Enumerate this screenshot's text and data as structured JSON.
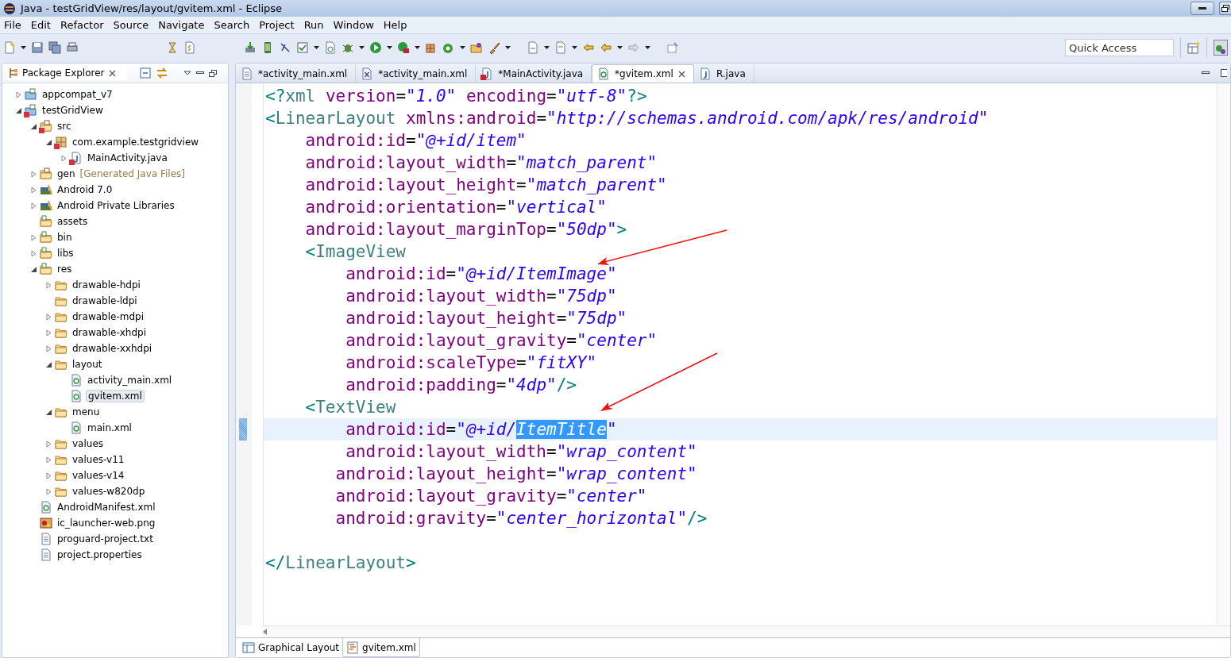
{
  "window": {
    "title": "Java - testGridView/res/layout/gvitem.xml - Eclipse"
  },
  "menu_items": [
    "File",
    "Edit",
    "Refactor",
    "Source",
    "Navigate",
    "Search",
    "Project",
    "Run",
    "Window",
    "Help"
  ],
  "quick_access": {
    "placeholder": "Quick Access"
  },
  "explorer": {
    "title": "Package Explorer",
    "items": [
      {
        "label": "appcompat_v7",
        "kind": "project",
        "selected": false,
        "expanded": false
      },
      {
        "label": "testGridView",
        "kind": "project",
        "selected": false,
        "error": true,
        "expanded": true,
        "children": [
          {
            "label": "src",
            "kind": "srcfolder",
            "selected": false,
            "error": true,
            "expanded": true,
            "children": [
              {
                "label": "com.example.testgridview",
                "kind": "package",
                "selected": false,
                "error": true,
                "expanded": true,
                "children": [
                  {
                    "label": "MainActivity.java",
                    "kind": "java",
                    "selected": false,
                    "error": true,
                    "expanded": false
                  }
                ]
              }
            ]
          },
          {
            "label": "gen",
            "decoration": "[Generated Java Files]",
            "kind": "srcfolder",
            "selected": false,
            "expanded": false
          },
          {
            "label": "Android 7.0",
            "kind": "library",
            "selected": false,
            "expanded": false
          },
          {
            "label": "Android Private Libraries",
            "kind": "library",
            "selected": false,
            "expanded": false
          },
          {
            "label": "assets",
            "kind": "folder",
            "selected": false
          },
          {
            "label": "bin",
            "kind": "folder",
            "selected": false,
            "expanded": false
          },
          {
            "label": "libs",
            "kind": "folder",
            "selected": false,
            "expanded": false
          },
          {
            "label": "res",
            "kind": "folder",
            "selected": false,
            "expanded": true,
            "children": [
              {
                "label": "drawable-hdpi",
                "kind": "plainfolder",
                "selected": false,
                "expanded": false
              },
              {
                "label": "drawable-ldpi",
                "kind": "plainfolder",
                "selected": false
              },
              {
                "label": "drawable-mdpi",
                "kind": "plainfolder",
                "selected": false,
                "expanded": false
              },
              {
                "label": "drawable-xhdpi",
                "kind": "plainfolder",
                "selected": false,
                "expanded": false
              },
              {
                "label": "drawable-xxhdpi",
                "kind": "plainfolder",
                "selected": false,
                "expanded": false
              },
              {
                "label": "layout",
                "kind": "plainfolder",
                "selected": false,
                "expanded": true,
                "children": [
                  {
                    "label": "activity_main.xml",
                    "kind": "xml",
                    "selected": false
                  },
                  {
                    "label": "gvitem.xml",
                    "kind": "xml",
                    "selected": true
                  }
                ]
              },
              {
                "label": "menu",
                "kind": "plainfolder",
                "selected": false,
                "expanded": true,
                "children": [
                  {
                    "label": "main.xml",
                    "kind": "xml",
                    "selected": false
                  }
                ]
              },
              {
                "label": "values",
                "kind": "plainfolder",
                "selected": false,
                "expanded": false
              },
              {
                "label": "values-v11",
                "kind": "plainfolder",
                "selected": false,
                "expanded": false
              },
              {
                "label": "values-v14",
                "kind": "plainfolder",
                "selected": false,
                "expanded": false
              },
              {
                "label": "values-w820dp",
                "kind": "plainfolder",
                "selected": false,
                "expanded": false
              }
            ]
          },
          {
            "label": "AndroidManifest.xml",
            "kind": "xml",
            "selected": false
          },
          {
            "label": "ic_launcher-web.png",
            "kind": "image",
            "selected": false
          },
          {
            "label": "proguard-project.txt",
            "kind": "text",
            "selected": false
          },
          {
            "label": "project.properties",
            "kind": "text",
            "selected": false
          }
        ]
      }
    ]
  },
  "editor_tabs": [
    {
      "label": "*activity_main.xml",
      "kind": "text",
      "selected": false
    },
    {
      "label": "*activity_main.xml",
      "kind": "xmlx",
      "selected": false
    },
    {
      "label": "*MainActivity.java",
      "kind": "java-error",
      "selected": false
    },
    {
      "label": "*gvitem.xml",
      "kind": "xml",
      "selected": true
    },
    {
      "label": "R.java",
      "kind": "java",
      "selected": false
    }
  ],
  "code": [
    {
      "tokens": [
        {
          "kind": "bracket",
          "text": "<?"
        },
        {
          "kind": "tag",
          "text": "xml"
        },
        {
          "kind": "attr",
          "text": " version"
        },
        {
          "kind": "eq",
          "text": "="
        },
        {
          "kind": "value",
          "text": "\"1.0\""
        },
        {
          "kind": "attr",
          "text": " encoding"
        },
        {
          "kind": "eq",
          "text": "="
        },
        {
          "kind": "value",
          "text": "\"utf-8\""
        },
        {
          "kind": "bracket",
          "text": "?>"
        }
      ]
    },
    {
      "tokens": [
        {
          "kind": "bracket",
          "text": "<"
        },
        {
          "kind": "tag",
          "text": "LinearLayout"
        },
        {
          "kind": "attr",
          "text": " xmlns:android"
        },
        {
          "kind": "eq",
          "text": "="
        },
        {
          "kind": "value",
          "text": "\"http://schemas.android.com/apk/res/android\""
        }
      ]
    },
    {
      "tokens": [
        {
          "kind": "attr",
          "text": "    android:id"
        },
        {
          "kind": "eq",
          "text": "="
        },
        {
          "kind": "value",
          "text": "\"@+id/item\""
        }
      ]
    },
    {
      "tokens": [
        {
          "kind": "attr",
          "text": "    android:layout_width"
        },
        {
          "kind": "eq",
          "text": "="
        },
        {
          "kind": "value",
          "text": "\"match_parent\""
        }
      ]
    },
    {
      "tokens": [
        {
          "kind": "attr",
          "text": "    android:layout_height"
        },
        {
          "kind": "eq",
          "text": "="
        },
        {
          "kind": "value",
          "text": "\"match_parent\""
        }
      ]
    },
    {
      "tokens": [
        {
          "kind": "attr",
          "text": "    android:orientation"
        },
        {
          "kind": "eq",
          "text": "="
        },
        {
          "kind": "value",
          "text": "\"vertical\""
        }
      ]
    },
    {
      "tokens": [
        {
          "kind": "attr",
          "text": "    android:layout_marginTop"
        },
        {
          "kind": "eq",
          "text": "="
        },
        {
          "kind": "value",
          "text": "\"50dp\""
        },
        {
          "kind": "bracket",
          "text": ">"
        }
      ]
    },
    {
      "tokens": [
        {
          "kind": "bracket",
          "text": "    <"
        },
        {
          "kind": "tag",
          "text": "ImageView"
        }
      ]
    },
    {
      "tokens": [
        {
          "kind": "attr",
          "text": "        android:id"
        },
        {
          "kind": "eq",
          "text": "="
        },
        {
          "kind": "value",
          "text": "\"@+id/ItemImage\""
        }
      ]
    },
    {
      "tokens": [
        {
          "kind": "attr",
          "text": "        android:layout_width"
        },
        {
          "kind": "eq",
          "text": "="
        },
        {
          "kind": "value",
          "text": "\"75dp\""
        }
      ]
    },
    {
      "tokens": [
        {
          "kind": "attr",
          "text": "        android:layout_height"
        },
        {
          "kind": "eq",
          "text": "="
        },
        {
          "kind": "value",
          "text": "\"75dp\""
        }
      ]
    },
    {
      "tokens": [
        {
          "kind": "attr",
          "text": "        android:layout_gravity"
        },
        {
          "kind": "eq",
          "text": "="
        },
        {
          "kind": "value",
          "text": "\"center\""
        }
      ]
    },
    {
      "tokens": [
        {
          "kind": "attr",
          "text": "        android:scaleType"
        },
        {
          "kind": "eq",
          "text": "="
        },
        {
          "kind": "value",
          "text": "\"fitXY\""
        }
      ]
    },
    {
      "tokens": [
        {
          "kind": "attr",
          "text": "        android:padding"
        },
        {
          "kind": "eq",
          "text": "="
        },
        {
          "kind": "value",
          "text": "\"4dp\""
        },
        {
          "kind": "bracket",
          "text": "/>"
        }
      ]
    },
    {
      "tokens": [
        {
          "kind": "bracket",
          "text": "    <"
        },
        {
          "kind": "tag",
          "text": "TextView"
        }
      ]
    },
    {
      "current": true,
      "tokens": [
        {
          "kind": "attr",
          "text": "        android:id"
        },
        {
          "kind": "eq",
          "text": "="
        },
        {
          "kind": "value",
          "text": "\"@+id/"
        },
        {
          "kind": "value",
          "text": "ItemTitle",
          "selected": true
        },
        {
          "kind": "value",
          "text": "\""
        }
      ]
    },
    {
      "tokens": [
        {
          "kind": "attr",
          "text": "        android:layout_width"
        },
        {
          "kind": "eq",
          "text": "="
        },
        {
          "kind": "value",
          "text": "\"wrap_content\""
        }
      ]
    },
    {
      "tokens": [
        {
          "kind": "attr",
          "text": "       android:layout_height"
        },
        {
          "kind": "eq",
          "text": "="
        },
        {
          "kind": "value",
          "text": "\"wrap_content\""
        }
      ]
    },
    {
      "tokens": [
        {
          "kind": "attr",
          "text": "       android:layout_gravity"
        },
        {
          "kind": "eq",
          "text": "="
        },
        {
          "kind": "value",
          "text": "\"center\""
        }
      ]
    },
    {
      "tokens": [
        {
          "kind": "attr",
          "text": "       android:gravity"
        },
        {
          "kind": "eq",
          "text": "="
        },
        {
          "kind": "value",
          "text": "\"center_horizontal\""
        },
        {
          "kind": "bracket",
          "text": "/>"
        }
      ]
    },
    {
      "kind": "blank"
    },
    {
      "tokens": [
        {
          "kind": "bracket",
          "text": "</"
        },
        {
          "kind": "tag",
          "text": "LinearLayout"
        },
        {
          "kind": "bracket",
          "text": ">"
        }
      ]
    }
  ],
  "bottom_tabs": [
    {
      "label": "Graphical Layout",
      "kind": "layout",
      "selected": false
    },
    {
      "label": "gvitem.xml",
      "kind": "source",
      "selected": true
    }
  ]
}
